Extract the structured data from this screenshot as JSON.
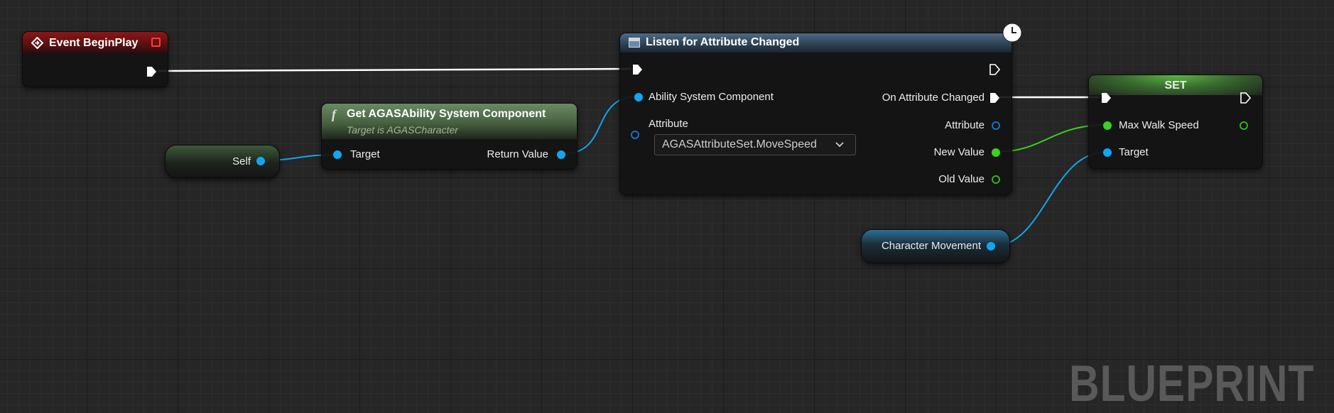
{
  "nodes": {
    "event_begin_play": {
      "title": "Event BeginPlay"
    },
    "get_asc": {
      "title": "Get AGASAbility System Component",
      "subtitle": "Target is AGASCharacter",
      "input_target": "Target",
      "output_return": "Return Value"
    },
    "self_node": {
      "label": "Self"
    },
    "listen": {
      "title": "Listen for Attribute Changed",
      "input_asc": "Ability System Component",
      "input_attribute": "Attribute",
      "attribute_value": "AGASAttributeSet.MoveSpeed",
      "out_changed": "On Attribute Changed",
      "out_attribute": "Attribute",
      "out_new_value": "New Value",
      "out_old_value": "Old Value"
    },
    "set_node": {
      "title": "SET",
      "input_speed": "Max Walk Speed",
      "input_target": "Target"
    },
    "char_movement": {
      "label": "Character Movement"
    }
  },
  "watermark": "BLUEPRINT",
  "colors": {
    "object_pin": "#12a6ee",
    "float_pin": "#3bd11d",
    "exec_pin": "#ffffff",
    "event_header": "#8b1717",
    "pure_function_header": "#47613f",
    "async_header": "#2e4356"
  },
  "icons": [
    "event-icon",
    "stop-icon",
    "function-icon",
    "async-task-icon",
    "clock-icon",
    "dropdown-chevron-icon"
  ]
}
